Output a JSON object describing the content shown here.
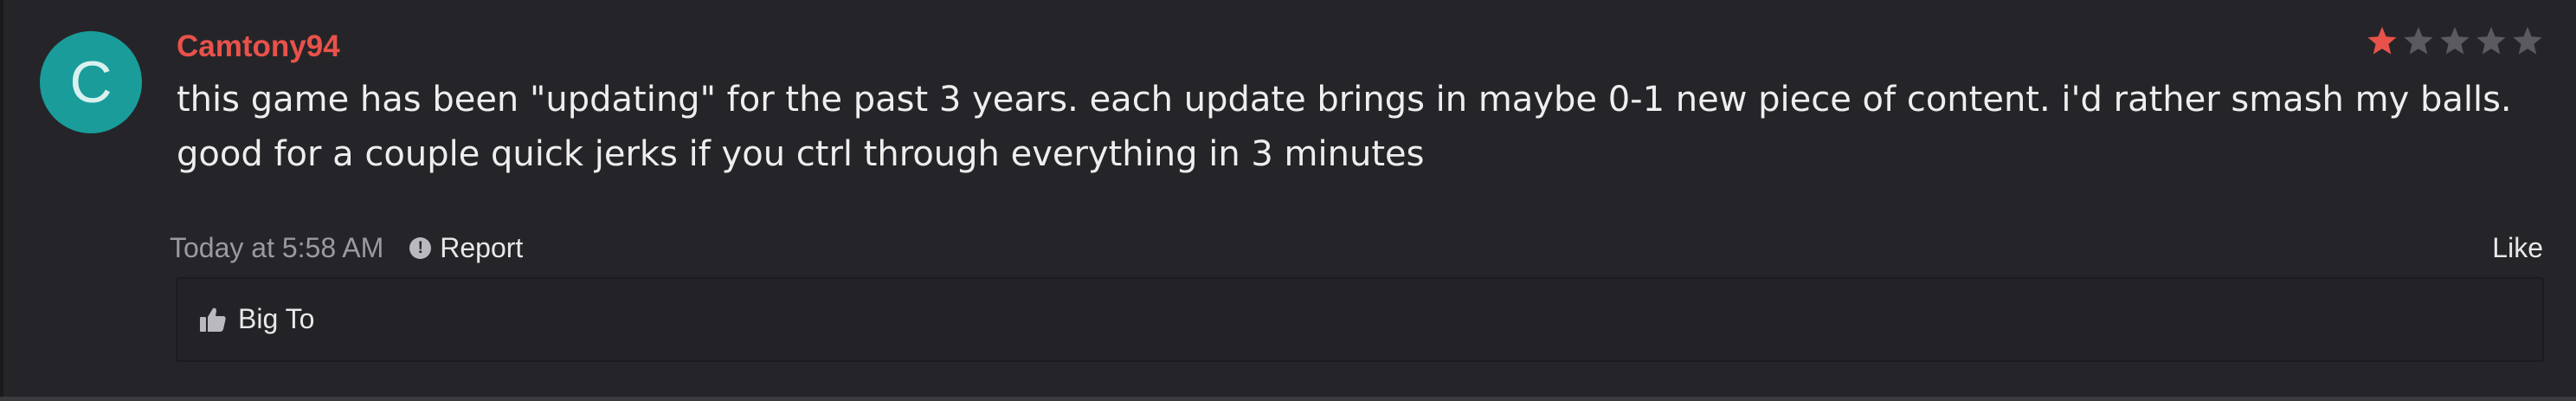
{
  "review": {
    "avatar_letter": "C",
    "username": "Camtony94",
    "rating": 1,
    "max_rating": 5,
    "text": "this game has been \"updating\" for the past 3 years. each update brings in maybe 0-1 new piece of content. i'd rather smash my balls. good for a couple quick jerks if you ctrl through everything in 3 minutes",
    "timestamp": "Today at 5:58 AM",
    "report_label": "Report",
    "like_label": "Like"
  },
  "reactions": {
    "liked_by": "Big To",
    "icon": "thumbs-up-icon"
  },
  "colors": {
    "background": "#252529",
    "username": "#e9524a",
    "star_filled": "#e9524a",
    "star_empty": "#5a5a60",
    "avatar": "#1a9c9a",
    "text": "#eeeeee",
    "muted": "#9a9aa2"
  }
}
